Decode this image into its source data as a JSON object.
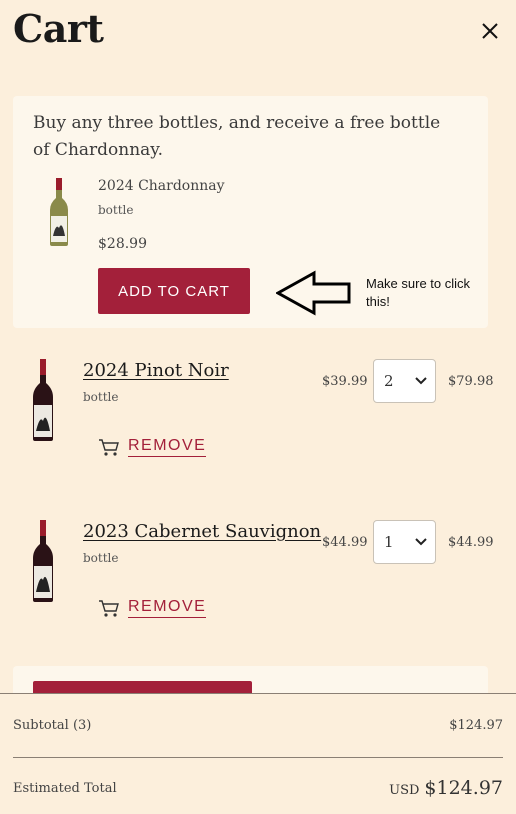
{
  "header": {
    "title": "Cart"
  },
  "promo": {
    "message": "Buy any three bottles, and receive a free bottle of Chardonnay.",
    "product_name": "2024 Chardonnay",
    "unit": "bottle",
    "price": "$28.99",
    "add_button": "ADD TO CART"
  },
  "annotation": {
    "note": "Make sure to click this!"
  },
  "items": [
    {
      "name": "2024 Pinot Noir",
      "unit": "bottle",
      "price": "$39.99",
      "qty": "2",
      "total": "$79.98",
      "remove": "REMOVE"
    },
    {
      "name": "2023 Cabernet Sauvignon",
      "unit": "bottle",
      "price": "$44.99",
      "qty": "1",
      "total": "$44.99",
      "remove": "REMOVE"
    }
  ],
  "summary": {
    "subtotal_label": "Subtotal",
    "subtotal_count": "(3)",
    "subtotal_value": "$124.97",
    "estimated_label": "Estimated Total",
    "currency": "USD",
    "estimated_value": "$124.97"
  },
  "colors": {
    "background": "#fcefdc",
    "card": "#fdf7ec",
    "accent": "#a3203a"
  },
  "icons": {
    "close": "close-icon",
    "remove": "cart-icon",
    "qty": "chevron-down-icon"
  }
}
